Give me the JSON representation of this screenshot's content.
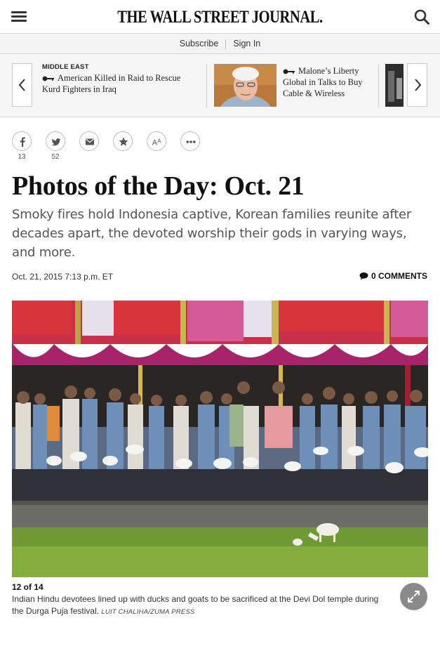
{
  "header": {
    "logo": "THE WALL STREET JOURNAL.",
    "menu_icon": "hamburger-menu-icon",
    "search_icon": "search-icon"
  },
  "subscribe_bar": {
    "subscribe_label": "Subscribe",
    "signin_label": "Sign In"
  },
  "carousel": {
    "items": [
      {
        "category": "MIDDLE EAST",
        "headline": "American Killed in Raid to Rescue Kurd Fighters in Iraq",
        "icon": "key-icon"
      },
      {
        "category": "",
        "headline": "Malone’s Liberty Global in Talks to Buy Cable & Wireless",
        "icon": "key-icon"
      }
    ],
    "prev_icon": "chevron-left-icon",
    "next_icon": "chevron-right-icon"
  },
  "share": {
    "facebook_count": "13",
    "twitter_count": "52",
    "icons": [
      "facebook-icon",
      "twitter-icon",
      "email-icon",
      "star-icon",
      "text-size-icon",
      "more-icon"
    ]
  },
  "article": {
    "headline": "Photos of the Day: Oct. 21",
    "dek": "Smoky fires hold Indonesia captive, Korean families reunite after decades apart, the devoted worship their gods in varying ways, and more.",
    "date": "Oct. 21, 2015 7:13 p.m. ET",
    "comments_label": "0 COMMENTS"
  },
  "photo": {
    "counter": "12 of 14",
    "caption": "Indian Hindu devotees lined up with ducks and goats to be sacrificed at the Devi Dol temple during the Durga Puja festival.",
    "credit": "LUIT CHALIHA/ZUMA PRESS",
    "expand_icon": "expand-icon"
  },
  "colors": {
    "text_dark": "#111111",
    "text_gray": "#555555",
    "border": "#d6d6d6",
    "bar_bg": "#f4f4f4",
    "expand_btn": "#8a8a8a"
  }
}
